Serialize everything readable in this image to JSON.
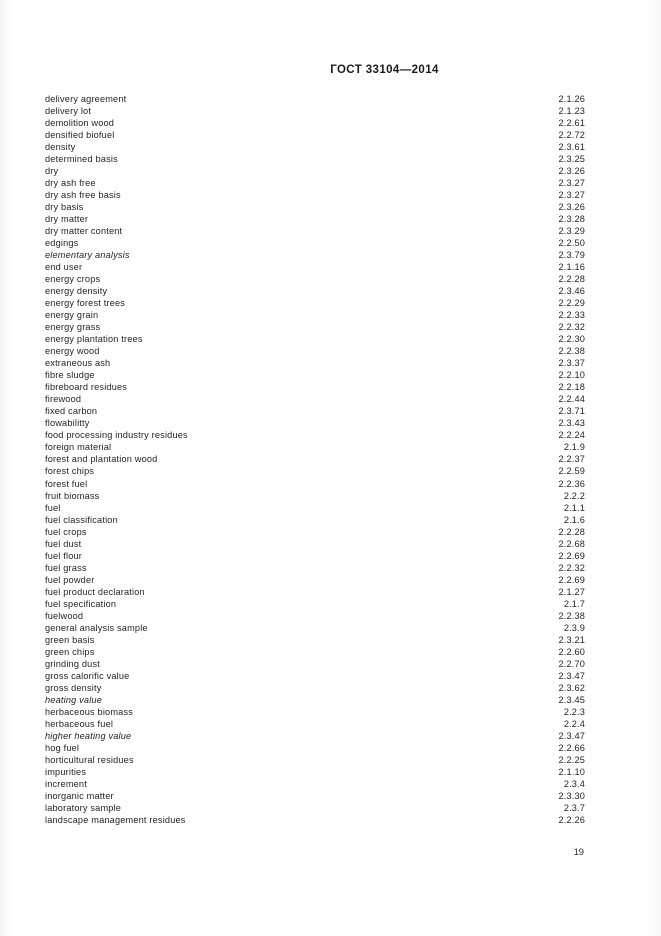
{
  "document": {
    "header_title": "ГОСТ 33104—2014",
    "page_number": "19"
  },
  "index": {
    "entries": [
      {
        "term": "delivery agreement",
        "ref": "2.1.26",
        "italic": false
      },
      {
        "term": "delivery lot",
        "ref": "2.1.23",
        "italic": false
      },
      {
        "term": "demolition wood",
        "ref": "2.2.61",
        "italic": false
      },
      {
        "term": "densified biofuel",
        "ref": "2.2.72",
        "italic": false
      },
      {
        "term": "density",
        "ref": "2.3.61",
        "italic": false
      },
      {
        "term": "determined basis",
        "ref": "2.3.25",
        "italic": false
      },
      {
        "term": "dry",
        "ref": "2.3.26",
        "italic": false
      },
      {
        "term": "dry ash free",
        "ref": "2.3.27",
        "italic": false
      },
      {
        "term": "dry ash free basis",
        "ref": "2.3.27",
        "italic": false
      },
      {
        "term": "dry basis",
        "ref": "2.3.26",
        "italic": false
      },
      {
        "term": "dry matter",
        "ref": "2.3.28",
        "italic": false
      },
      {
        "term": "dry matter content",
        "ref": "2.3.29",
        "italic": false
      },
      {
        "term": "edgings",
        "ref": "2.2.50",
        "italic": false
      },
      {
        "term": "elementary analysis",
        "ref": "2.3.79",
        "italic": true
      },
      {
        "term": "end user",
        "ref": "2.1.16",
        "italic": false
      },
      {
        "term": "energy crops",
        "ref": "2.2.28",
        "italic": false
      },
      {
        "term": "energy density",
        "ref": "2.3.46",
        "italic": false
      },
      {
        "term": "energy forest trees",
        "ref": "2.2.29",
        "italic": false
      },
      {
        "term": "energy grain",
        "ref": "2.2.33",
        "italic": false
      },
      {
        "term": "energy grass",
        "ref": "2.2.32",
        "italic": false
      },
      {
        "term": "energy plantation trees",
        "ref": "2.2.30",
        "italic": false
      },
      {
        "term": "energy wood",
        "ref": "2.2.38",
        "italic": false
      },
      {
        "term": "extraneous ash",
        "ref": "2.3.37",
        "italic": false
      },
      {
        "term": "fibre sludge",
        "ref": "2.2.10",
        "italic": false
      },
      {
        "term": "fibreboard residues",
        "ref": "2.2.18",
        "italic": false
      },
      {
        "term": "firewood",
        "ref": "2.2.44",
        "italic": false
      },
      {
        "term": "fixed carbon",
        "ref": "2.3.71",
        "italic": false
      },
      {
        "term": "flowabilitty",
        "ref": "2.3.43",
        "italic": false
      },
      {
        "term": "food processing industry residues",
        "ref": "2.2.24",
        "italic": false
      },
      {
        "term": "foreign material",
        "ref": "2.1.9",
        "italic": false
      },
      {
        "term": "forest and plantation wood",
        "ref": "2.2.37",
        "italic": false
      },
      {
        "term": "forest chips",
        "ref": "2.2.59",
        "italic": false
      },
      {
        "term": "forest fuel",
        "ref": "2.2.36",
        "italic": false
      },
      {
        "term": "fruit biomass",
        "ref": "2.2.2",
        "italic": false
      },
      {
        "term": "fuel",
        "ref": "2.1.1",
        "italic": false
      },
      {
        "term": "fuel classification",
        "ref": "2.1.6",
        "italic": false
      },
      {
        "term": "fuel crops",
        "ref": "2.2.28",
        "italic": false
      },
      {
        "term": "fuel dust",
        "ref": "2.2.68",
        "italic": false
      },
      {
        "term": "fuel flour",
        "ref": "2.2.69",
        "italic": false
      },
      {
        "term": "fuel grass",
        "ref": "2.2.32",
        "italic": false
      },
      {
        "term": "fuel powder",
        "ref": "2.2.69",
        "italic": false
      },
      {
        "term": "fuel product declaration",
        "ref": "2.1.27",
        "italic": false
      },
      {
        "term": "fuel specification",
        "ref": "2.1.7",
        "italic": false
      },
      {
        "term": "fuelwood",
        "ref": "2.2.38",
        "italic": false
      },
      {
        "term": "general analysis sample",
        "ref": "2.3.9",
        "italic": false
      },
      {
        "term": "green basis",
        "ref": "2.3.21",
        "italic": false
      },
      {
        "term": "green chips",
        "ref": "2.2.60",
        "italic": false
      },
      {
        "term": "grinding dust",
        "ref": "2.2.70",
        "italic": false
      },
      {
        "term": "gross calorific value",
        "ref": "2.3.47",
        "italic": false
      },
      {
        "term": "gross density",
        "ref": "2.3.62",
        "italic": false
      },
      {
        "term": "heating value",
        "ref": "2.3.45",
        "italic": true
      },
      {
        "term": "herbaceous biomass",
        "ref": "2.2.3",
        "italic": false
      },
      {
        "term": "herbaceous fuel",
        "ref": "2.2.4",
        "italic": false
      },
      {
        "term": "higher heating value",
        "ref": "2.3.47",
        "italic": true
      },
      {
        "term": "hog fuel",
        "ref": "2.2.66",
        "italic": false
      },
      {
        "term": "horticultural residues",
        "ref": "2.2.25",
        "italic": false
      },
      {
        "term": "impurities",
        "ref": "2.1.10",
        "italic": false
      },
      {
        "term": "increment",
        "ref": "2.3.4",
        "italic": false
      },
      {
        "term": "inorganic matter",
        "ref": "2.3.30",
        "italic": false
      },
      {
        "term": "laboratory sample",
        "ref": "2.3.7",
        "italic": false
      },
      {
        "term": "landscape management residues",
        "ref": "2.2.26",
        "italic": false
      }
    ]
  }
}
